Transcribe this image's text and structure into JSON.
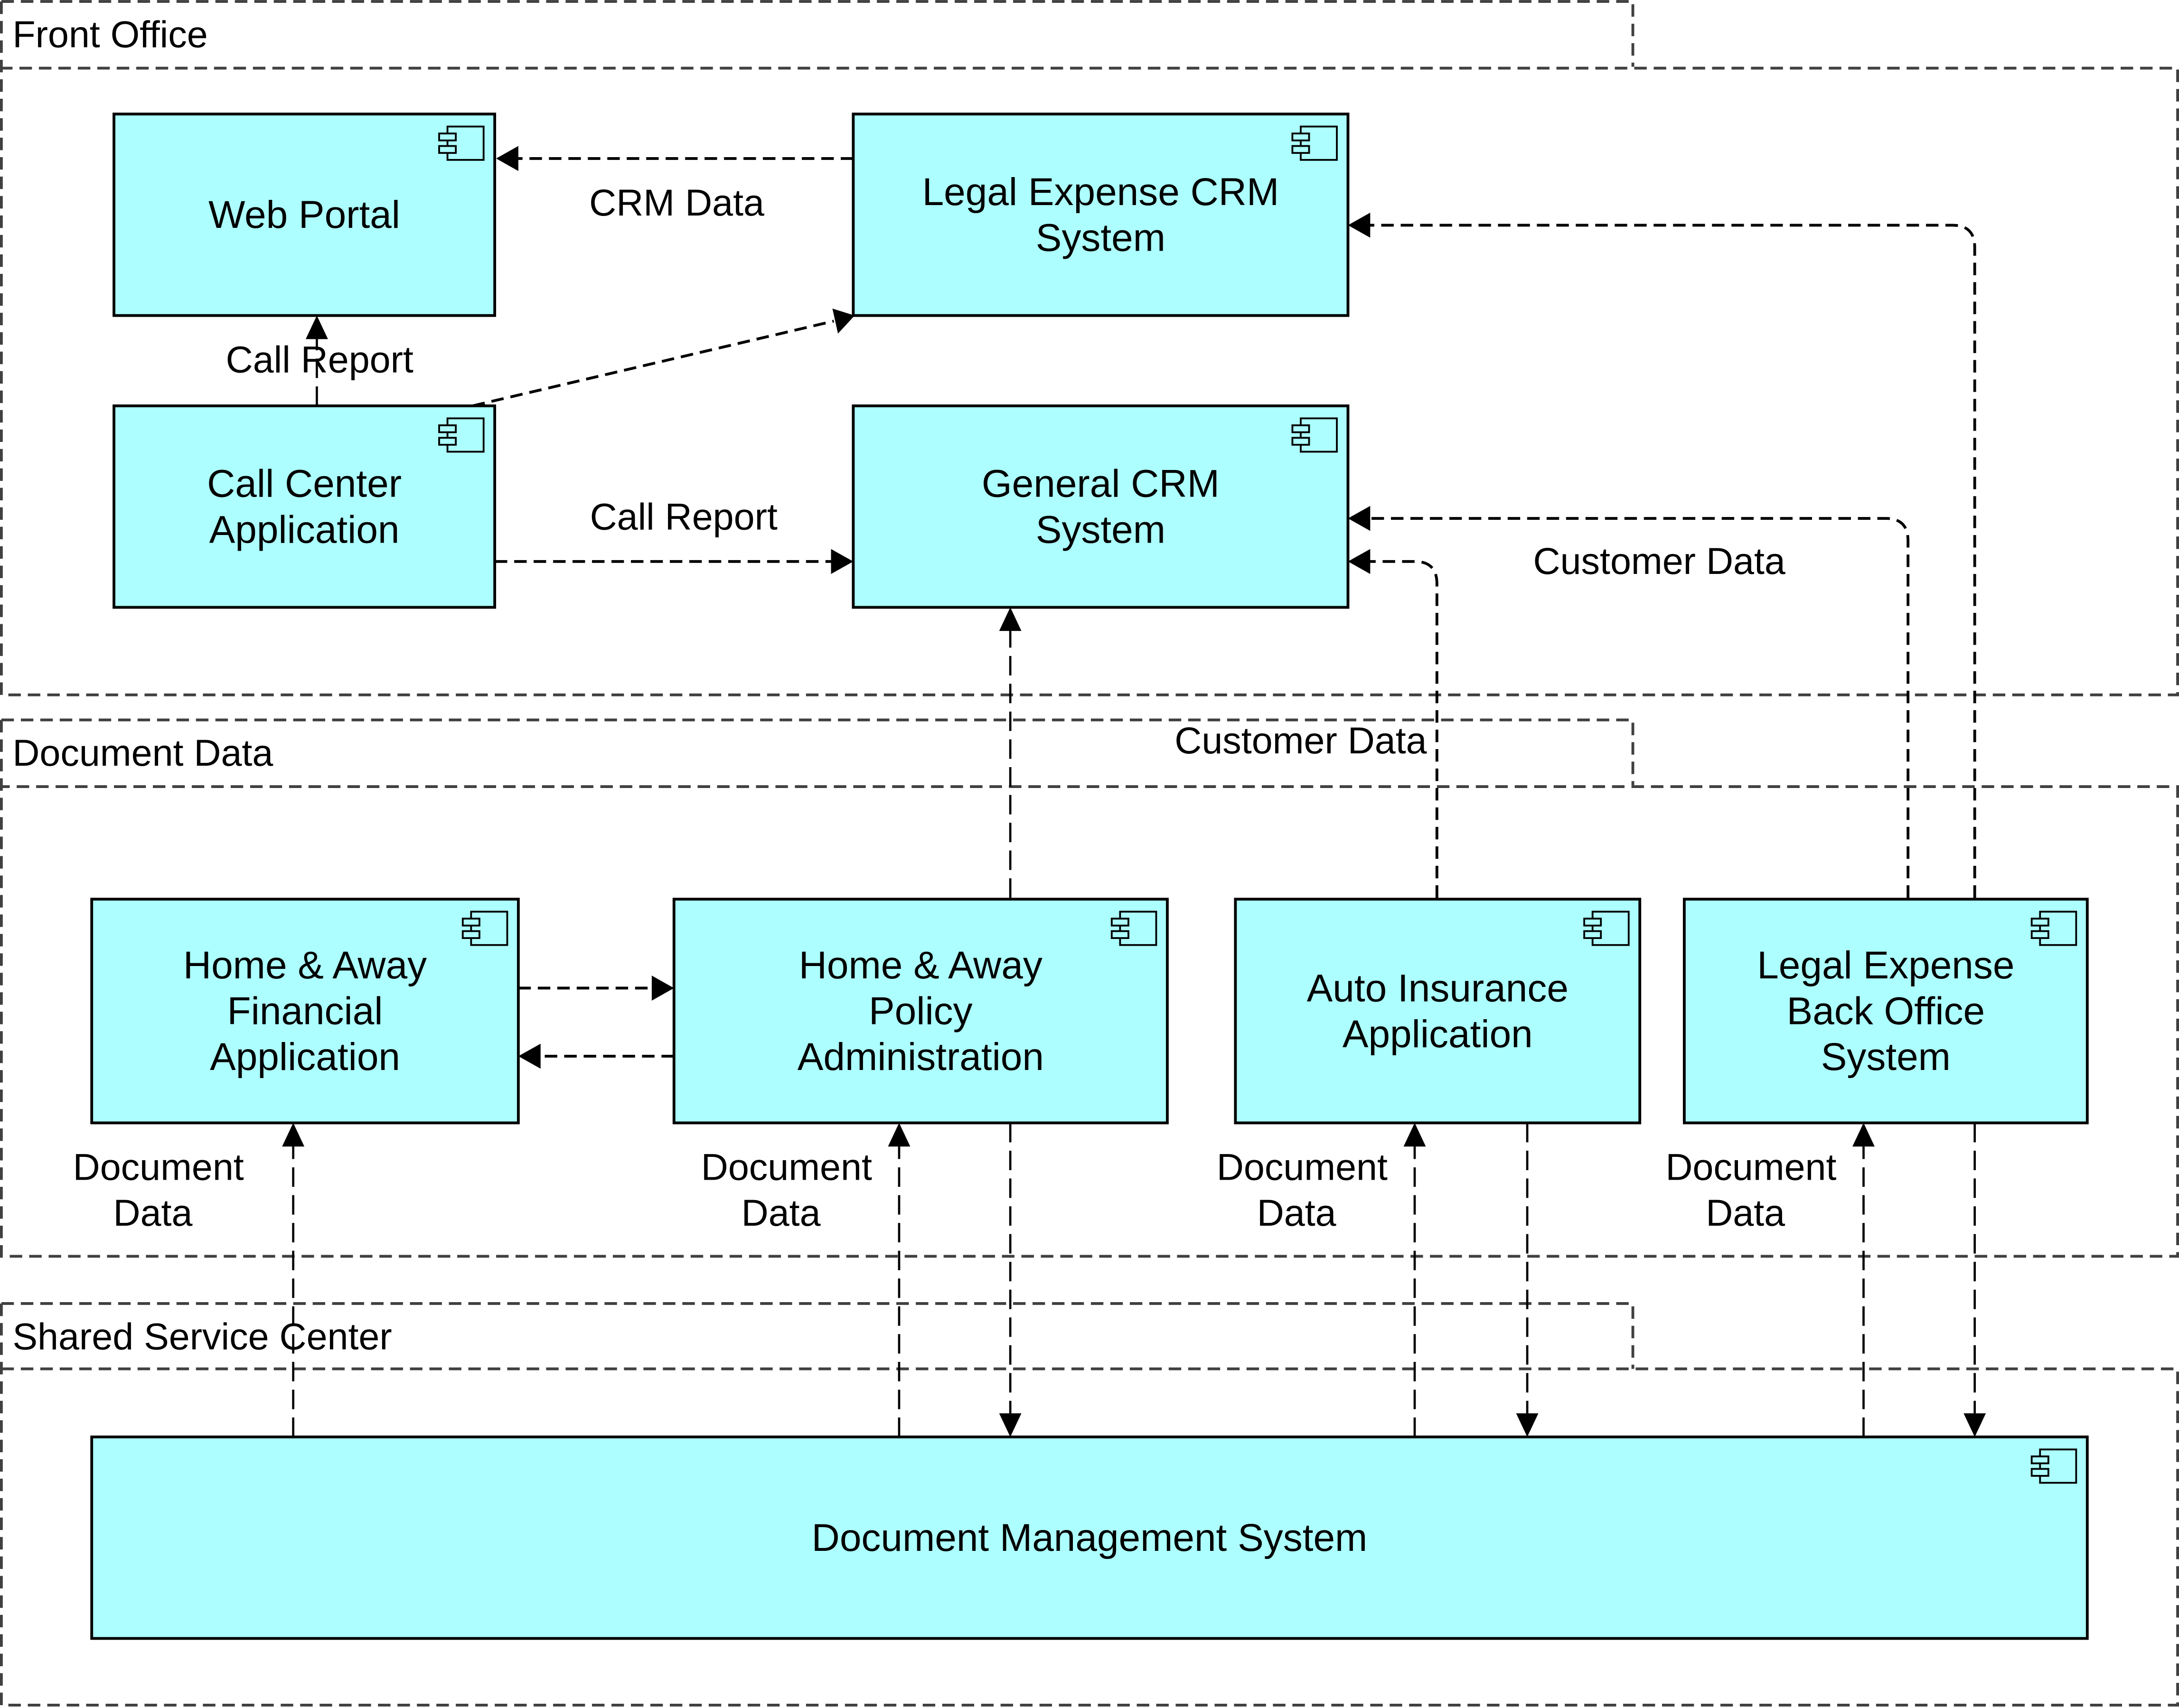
{
  "diagram": {
    "colors": {
      "component_fill": "#adffff",
      "component_stroke": "#000000",
      "group_stroke": "#404040",
      "edge_stroke": "#000000"
    },
    "groups": [
      {
        "id": "front-office",
        "label": "Front Office"
      },
      {
        "id": "document-data",
        "label": "Document Data"
      },
      {
        "id": "shared-service-center",
        "label": "Shared Service Center"
      }
    ],
    "components": [
      {
        "id": "web-portal",
        "lines": [
          "Web Portal"
        ],
        "icon": "component-icon"
      },
      {
        "id": "legal-expense-crm",
        "lines": [
          "Legal Expense CRM",
          "System"
        ],
        "icon": "component-icon"
      },
      {
        "id": "call-center",
        "lines": [
          "Call Center",
          "Application"
        ],
        "icon": "component-icon"
      },
      {
        "id": "general-crm",
        "lines": [
          "General CRM",
          "System"
        ],
        "icon": "component-icon"
      },
      {
        "id": "home-away-financial",
        "lines": [
          "Home & Away",
          "Financial",
          "Application"
        ],
        "icon": "component-icon"
      },
      {
        "id": "home-away-policy",
        "lines": [
          "Home & Away",
          "Policy",
          "Administration"
        ],
        "icon": "component-icon"
      },
      {
        "id": "auto-insurance",
        "lines": [
          "Auto Insurance",
          "Application"
        ],
        "icon": "component-icon"
      },
      {
        "id": "legal-expense-back-office",
        "lines": [
          "Legal Expense",
          "Back Office",
          "System"
        ],
        "icon": "component-icon"
      },
      {
        "id": "document-management",
        "lines": [
          "Document Management System"
        ],
        "icon": "component-icon"
      }
    ],
    "flows": [
      {
        "from": "legal-expense-crm",
        "to": "web-portal",
        "label": "CRM Data"
      },
      {
        "from": "call-center",
        "to": "web-portal",
        "label": "Call Report"
      },
      {
        "from": "call-center",
        "to": "legal-expense-crm",
        "label": ""
      },
      {
        "from": "call-center",
        "to": "general-crm",
        "label": "Call Report"
      },
      {
        "from": "legal-expense-back-office",
        "to": "legal-expense-crm",
        "label": ""
      },
      {
        "from": "legal-expense-back-office",
        "to": "general-crm",
        "label": "Customer Data"
      },
      {
        "from": "auto-insurance",
        "to": "general-crm",
        "label": ""
      },
      {
        "from": "home-away-policy",
        "to": "general-crm",
        "label": "Customer Data"
      },
      {
        "from": "home-away-financial",
        "to": "home-away-policy",
        "label": ""
      },
      {
        "from": "home-away-policy",
        "to": "home-away-financial",
        "label": ""
      },
      {
        "from": "document-management",
        "to": "home-away-financial",
        "label": "Document Data"
      },
      {
        "from": "document-management",
        "to": "home-away-policy",
        "label": "Document Data"
      },
      {
        "from": "home-away-policy",
        "to": "document-management",
        "label": ""
      },
      {
        "from": "document-management",
        "to": "auto-insurance",
        "label": "Document Data"
      },
      {
        "from": "auto-insurance",
        "to": "document-management",
        "label": ""
      },
      {
        "from": "document-management",
        "to": "legal-expense-back-office",
        "label": "Document Data"
      },
      {
        "from": "legal-expense-back-office",
        "to": "document-management",
        "label": ""
      }
    ],
    "edge_labels": {
      "crm_data": "CRM Data",
      "call_report_top": "Call Report",
      "call_report_mid": "Call Report",
      "customer_data_right": "Customer Data",
      "customer_data_center": "Customer Data",
      "doc_data_1": [
        "Document",
        "Data"
      ],
      "doc_data_2": [
        "Document",
        "Data"
      ],
      "doc_data_3": [
        "Document",
        "Data"
      ],
      "doc_data_4": [
        "Document",
        "Data"
      ]
    }
  }
}
